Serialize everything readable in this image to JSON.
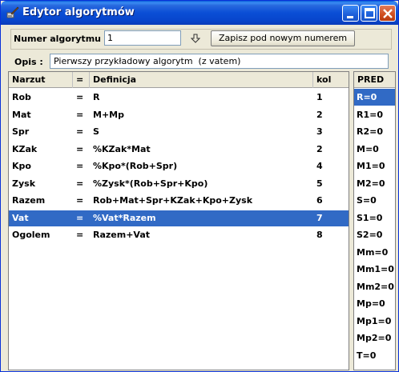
{
  "window": {
    "title": "Edytor algorytmów"
  },
  "form": {
    "number_label": "Numer algorytmu :",
    "number_value": "1",
    "save_button": "Zapisz pod nowym numerem",
    "description_label": "Opis :",
    "description_value": "Pierwszy przykładowy algorytm  (z vatem)"
  },
  "table": {
    "columns": [
      "Narzut",
      "=",
      "Definicja",
      "kol"
    ],
    "rows": [
      {
        "narzut": "Rob",
        "eq": "=",
        "definicja": "R",
        "kol": "1"
      },
      {
        "narzut": "Mat",
        "eq": "=",
        "definicja": "M+Mp",
        "kol": "2"
      },
      {
        "narzut": "Spr",
        "eq": "=",
        "definicja": "S",
        "kol": "3"
      },
      {
        "narzut": "KZak",
        "eq": "=",
        "definicja": "%KZak*Mat",
        "kol": "2"
      },
      {
        "narzut": "Kpo",
        "eq": "=",
        "definicja": "%Kpo*(Rob+Spr)",
        "kol": "4"
      },
      {
        "narzut": "Zysk",
        "eq": "=",
        "definicja": "%Zysk*(Rob+Spr+Kpo)",
        "kol": "5"
      },
      {
        "narzut": "Razem",
        "eq": "=",
        "definicja": "Rob+Mat+Spr+KZak+Kpo+Zysk",
        "kol": "6"
      },
      {
        "narzut": "Vat",
        "eq": "=",
        "definicja": "%Vat*Razem",
        "kol": "7"
      },
      {
        "narzut": "Ogolem",
        "eq": "=",
        "definicja": "Razem+Vat",
        "kol": "8"
      }
    ],
    "selected_row": 7
  },
  "pred": {
    "header": "PRED",
    "items": [
      "R=0",
      "R1=0",
      "R2=0",
      "M=0",
      "M1=0",
      "M2=0",
      "S=0",
      "S1=0",
      "S2=0",
      "Mm=0",
      "Mm1=0",
      "Mm2=0",
      "Mp=0",
      "Mp1=0",
      "Mp2=0",
      "T=0"
    ],
    "selected_item": 0
  },
  "icons": {
    "app": "brush-icon",
    "arrow": "arrow-down-icon",
    "minimize": "minimize-icon",
    "maximize": "maximize-icon",
    "close": "close-icon"
  },
  "colors": {
    "selection": "#316ac5",
    "titlebar": "#0a4ed6"
  }
}
